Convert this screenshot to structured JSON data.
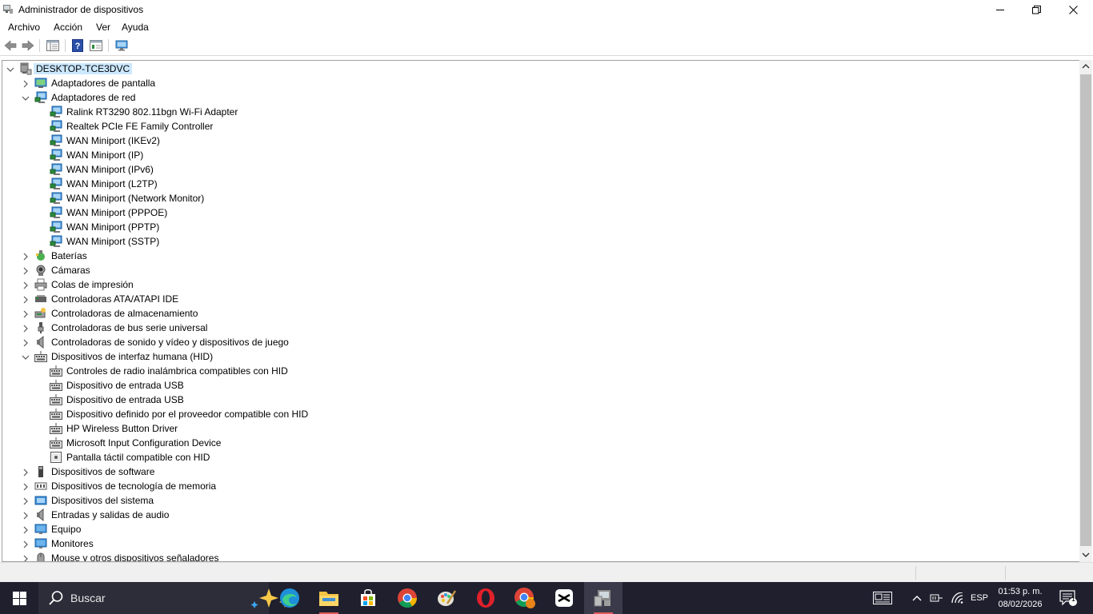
{
  "window": {
    "title": "Administrador de dispositivos"
  },
  "menu": [
    {
      "label": "Archivo"
    },
    {
      "label": "Acción"
    },
    {
      "label": "Ver"
    },
    {
      "label": "Ayuda"
    }
  ],
  "tree": [
    {
      "label": "DESKTOP-TCE3DVC",
      "level": 0,
      "expanded": true,
      "icon": "computer-icon",
      "name": "tree-root-computer"
    },
    {
      "label": "Adaptadores de pantalla",
      "level": 1,
      "expanded": false,
      "icon": "display-adapter-icon",
      "name": "tree-category-adaptadores-pantalla"
    },
    {
      "label": "Adaptadores de red",
      "level": 1,
      "expanded": true,
      "icon": "network-adapter-icon",
      "name": "tree-category-adaptadores-red"
    },
    {
      "label": "Ralink RT3290 802.11bgn Wi-Fi Adapter",
      "level": 2,
      "icon": "network-adapter-icon",
      "name": "tree-device"
    },
    {
      "label": "Realtek PCIe FE Family Controller",
      "level": 2,
      "icon": "network-adapter-icon",
      "name": "tree-device"
    },
    {
      "label": "WAN Miniport (IKEv2)",
      "level": 2,
      "icon": "network-adapter-icon",
      "name": "tree-device"
    },
    {
      "label": "WAN Miniport (IP)",
      "level": 2,
      "icon": "network-adapter-icon",
      "name": "tree-device"
    },
    {
      "label": "WAN Miniport (IPv6)",
      "level": 2,
      "icon": "network-adapter-icon",
      "name": "tree-device"
    },
    {
      "label": "WAN Miniport (L2TP)",
      "level": 2,
      "icon": "network-adapter-icon",
      "name": "tree-device"
    },
    {
      "label": "WAN Miniport (Network Monitor)",
      "level": 2,
      "icon": "network-adapter-icon",
      "name": "tree-device"
    },
    {
      "label": "WAN Miniport (PPPOE)",
      "level": 2,
      "icon": "network-adapter-icon",
      "name": "tree-device"
    },
    {
      "label": "WAN Miniport (PPTP)",
      "level": 2,
      "icon": "network-adapter-icon",
      "name": "tree-device"
    },
    {
      "label": "WAN Miniport (SSTP)",
      "level": 2,
      "icon": "network-adapter-icon",
      "name": "tree-device"
    },
    {
      "label": "Baterías",
      "level": 1,
      "expanded": false,
      "icon": "battery-icon",
      "name": "tree-category-baterias"
    },
    {
      "label": "Cámaras",
      "level": 1,
      "expanded": false,
      "icon": "camera-icon",
      "name": "tree-category-camaras"
    },
    {
      "label": "Colas de impresión",
      "level": 1,
      "expanded": false,
      "icon": "printer-icon",
      "name": "tree-category-colas-impresion"
    },
    {
      "label": "Controladoras ATA/ATAPI IDE",
      "level": 1,
      "expanded": false,
      "icon": "ide-controller-icon",
      "name": "tree-category-ata-atapi"
    },
    {
      "label": "Controladoras de almacenamiento",
      "level": 1,
      "expanded": false,
      "icon": "storage-controller-icon",
      "name": "tree-category-almacenamiento"
    },
    {
      "label": "Controladoras de bus serie universal",
      "level": 1,
      "expanded": false,
      "icon": "usb-icon",
      "name": "tree-category-usb"
    },
    {
      "label": "Controladoras de sonido y vídeo y dispositivos de juego",
      "level": 1,
      "expanded": false,
      "icon": "speaker-icon",
      "name": "tree-category-sonido-video"
    },
    {
      "label": "Dispositivos de interfaz humana (HID)",
      "level": 1,
      "expanded": true,
      "icon": "hid-icon",
      "name": "tree-category-hid"
    },
    {
      "label": "Controles de radio inalámbrica compatibles con HID",
      "level": 2,
      "icon": "hid-icon",
      "name": "tree-device"
    },
    {
      "label": "Dispositivo de entrada USB",
      "level": 2,
      "icon": "hid-icon",
      "name": "tree-device"
    },
    {
      "label": "Dispositivo de entrada USB",
      "level": 2,
      "icon": "hid-icon",
      "name": "tree-device"
    },
    {
      "label": "Dispositivo definido por el proveedor compatible con HID",
      "level": 2,
      "icon": "hid-icon",
      "name": "tree-device"
    },
    {
      "label": "HP Wireless Button Driver",
      "level": 2,
      "icon": "hid-icon",
      "name": "tree-device"
    },
    {
      "label": "Microsoft Input Configuration Device",
      "level": 2,
      "icon": "hid-icon",
      "name": "tree-device"
    },
    {
      "label": "Pantalla táctil compatible con HID",
      "level": 2,
      "icon": "touchscreen-icon",
      "name": "tree-device"
    },
    {
      "label": "Dispositivos de software",
      "level": 1,
      "expanded": false,
      "icon": "software-device-icon",
      "name": "tree-category-software"
    },
    {
      "label": "Dispositivos de tecnología de memoria",
      "level": 1,
      "expanded": false,
      "icon": "memory-icon",
      "name": "tree-category-memoria"
    },
    {
      "label": "Dispositivos del sistema",
      "level": 1,
      "expanded": false,
      "icon": "system-device-icon",
      "name": "tree-category-sistema"
    },
    {
      "label": "Entradas y salidas de audio",
      "level": 1,
      "expanded": false,
      "icon": "speaker-icon",
      "name": "tree-category-audio"
    },
    {
      "label": "Equipo",
      "level": 1,
      "expanded": false,
      "icon": "monitor-icon",
      "name": "tree-category-equipo"
    },
    {
      "label": "Monitores",
      "level": 1,
      "expanded": false,
      "icon": "monitor-icon",
      "name": "tree-category-monitores"
    },
    {
      "label": "Mouse y otros dispositivos señaladores",
      "level": 1,
      "expanded": false,
      "icon": "mouse-icon",
      "name": "tree-category-mouse"
    }
  ],
  "taskbar": {
    "search_label": "Buscar",
    "language": "ESP",
    "time": "01:53 p. m.",
    "date": "08/02/2026",
    "notification_count": "1"
  },
  "colors": {
    "selection": "#cce8ff",
    "taskbar": "#1f1f2e",
    "accent_blue": "#2f80d1"
  }
}
